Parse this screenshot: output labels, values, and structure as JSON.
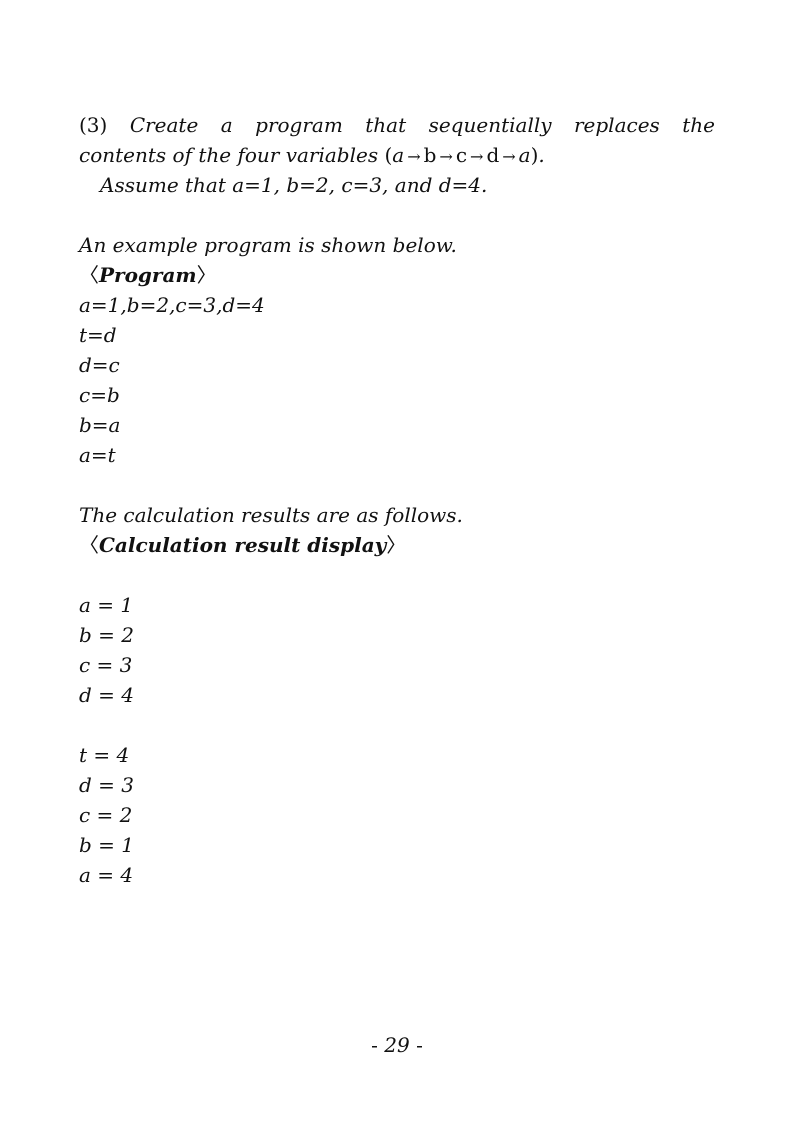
{
  "problem": {
    "number": "(3)",
    "line1_text": "Create a program that sequentially replaces the",
    "line2_text": "contents of the four variables",
    "sequence": [
      "a",
      "b",
      "c",
      "d",
      "a"
    ],
    "arrow": "→",
    "line2_end": ".",
    "assumption": "Assume that a=1, b=2, c=3, and d=4."
  },
  "program_section": {
    "intro": "An example program is shown below.",
    "heading_open": "〈",
    "heading": "Program",
    "heading_close": "〉",
    "lines": [
      "a=1,b=2,c=3,d=4",
      "t=d",
      "d=c",
      "c=b",
      "b=a",
      "a=t"
    ]
  },
  "results_section": {
    "intro": "The calculation results are as follows.",
    "heading_open": "〈",
    "heading": "Calculation result display",
    "heading_close": "〉",
    "initial": [
      "a = 1",
      "b = 2",
      "c = 3",
      "d = 4"
    ],
    "after": [
      "t = 4",
      "d = 3",
      "c = 2",
      "b = 1",
      "a = 4"
    ]
  },
  "footer": {
    "page_prefix": "- ",
    "page_number": "29",
    "page_suffix": " -"
  }
}
